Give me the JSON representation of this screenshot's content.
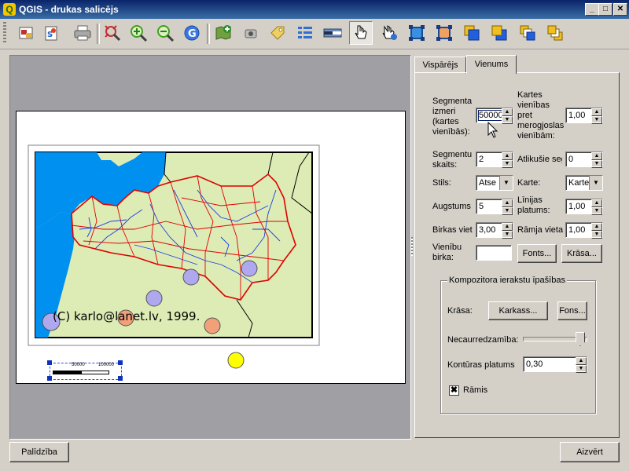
{
  "window": {
    "title": "QGIS - drukas salicējs",
    "app_icon": "Q"
  },
  "toolbar": {
    "items": [
      "export-image-icon",
      "export-svg-icon",
      "print-icon",
      "zoom-full-icon",
      "zoom-in-icon",
      "zoom-out-icon",
      "refresh-icon",
      "add-map-icon",
      "add-image-icon",
      "add-label-icon",
      "add-legend-icon",
      "add-scalebar-icon",
      "select-move-icon",
      "move-content-icon",
      "group-icon",
      "ungroup-icon",
      "raise-icon",
      "lower-icon",
      "move-top-icon",
      "move-bottom-icon"
    ]
  },
  "tabs": {
    "general": "Vispārējs",
    "item": "Vienums"
  },
  "form": {
    "segment_size_label": "Segmenta izmeri (kartes vienībās):",
    "segment_size_value": "50000",
    "map_units_label": "Kartes vienības pret merogjoslas vienībām:",
    "map_units_value": "1,00",
    "segments_label": "Segmentu skaits:",
    "segments_value": "2",
    "remaining_label": "Atlikušie seg",
    "remaining_value": "0",
    "style_label": "Stils:",
    "style_value": "Atse",
    "map_label": "Karte:",
    "map_value": "Karte",
    "height_label": "Augstums",
    "height_value": "5",
    "line_width_label": "Līnijas platums:",
    "line_width_value": "1,00",
    "label_space_label": "Birkas viet",
    "label_space_value": "3,00",
    "frame_space_label": "Rāmja vieta",
    "frame_space_value": "1,00",
    "unit_label_label": "Vienību birka:",
    "unit_label_value": "",
    "fonts_button": "Fonts...",
    "color_button": "Krāsa..."
  },
  "composer_group": {
    "title": "Kompozitora ierakstu īpašības",
    "color_label": "Krāsa:",
    "frame_button": "Karkass...",
    "background_button": "Fons...",
    "opacity_label": "Necaurredzamība:",
    "opacity_value": 0.9,
    "outline_label": "Kontūras platums",
    "outline_value": "0,30",
    "frame_checkbox_label": "Rāmis",
    "frame_checked": true
  },
  "map": {
    "copyright": "(C) karlo@lanet.lv, 1999.",
    "scalebar_labels": [
      "50000",
      "100000"
    ]
  },
  "footer": {
    "help_button": "Palīdzība",
    "close_button": "Aizvērt"
  },
  "colors": {
    "sea": "#0090f0",
    "land": "#ddebb5",
    "rivers": "#2040e0",
    "borders": "#e00000",
    "circle_blue": "#b0a8ee",
    "circle_orange": "#f2a07a",
    "circle_yellow": "#ffff00"
  }
}
